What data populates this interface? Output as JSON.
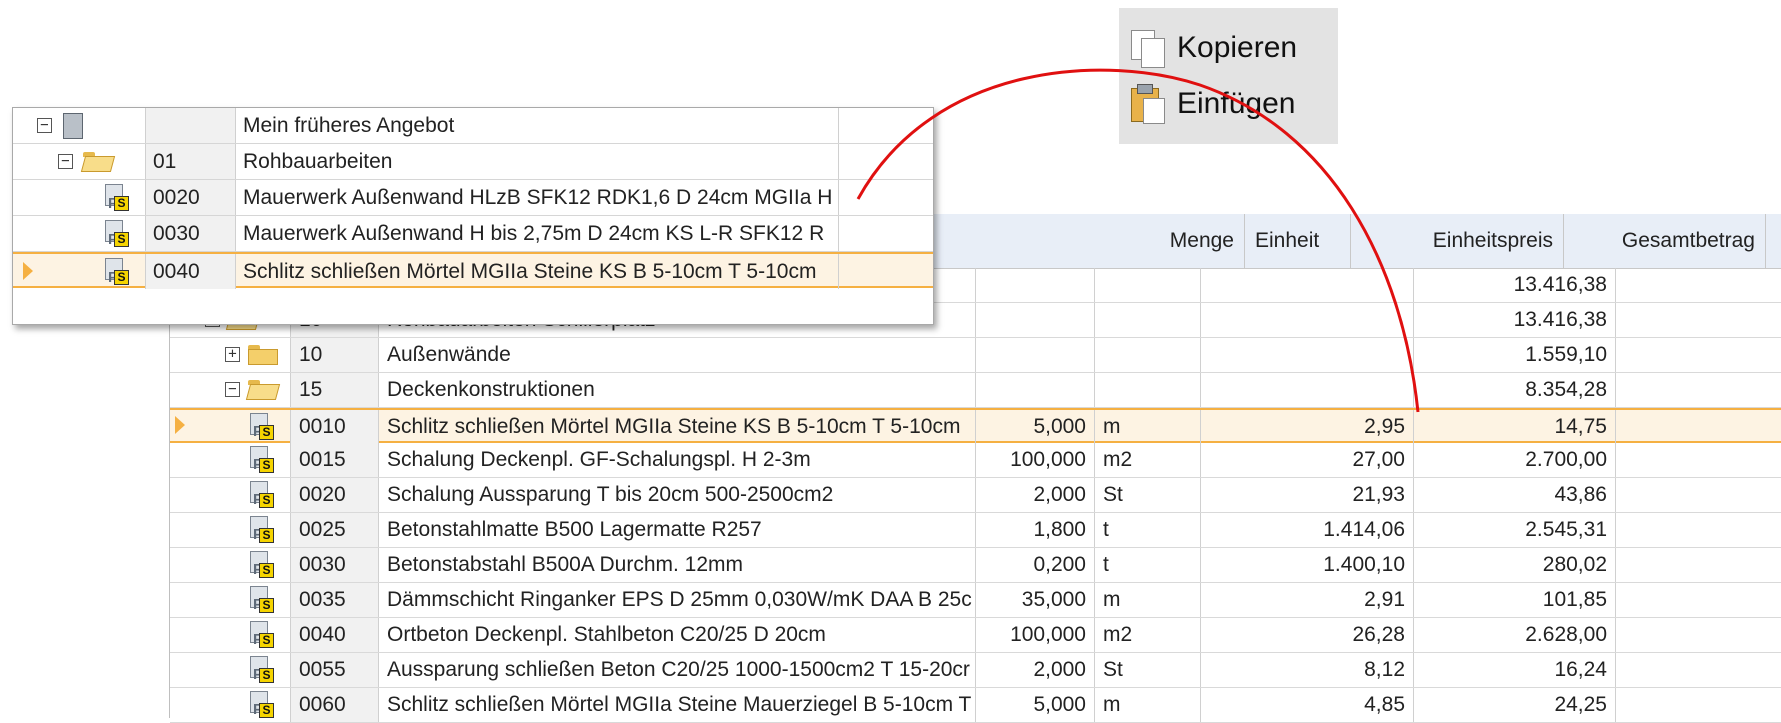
{
  "clipboard": {
    "copy_label": "Kopieren",
    "paste_label": "Einfügen",
    "copy_icon": "copy-icon",
    "paste_icon": "paste-icon"
  },
  "popup": {
    "rows": [
      {
        "code": "",
        "text": "Mein früheres Angebot"
      },
      {
        "code": "01",
        "text": "Rohbauarbeiten"
      },
      {
        "code": "0020",
        "text": "Mauerwerk Außenwand HLzB SFK12 RDK1,6 D 24cm MGIIa H"
      },
      {
        "code": "0030",
        "text": "Mauerwerk Außenwand H bis 2,75m D 24cm KS L-R SFK12 R"
      },
      {
        "code": "0040",
        "text": "Schlitz schließen Mörtel MGIIa Steine KS B 5-10cm T 5-10cm"
      }
    ]
  },
  "grid": {
    "headers": {
      "menge": "Menge",
      "einheit": "Einheit",
      "einheitspreis": "Einheitspreis",
      "gesamtbetrag": "Gesamtbetrag"
    },
    "rows": [
      {
        "code": "",
        "text": "",
        "menge": "",
        "einheit": "",
        "ep": "",
        "gb": "13.416,38"
      },
      {
        "code": "10",
        "text": "Rohbauarbeiten Schillerplatz",
        "menge": "",
        "einheit": "",
        "ep": "",
        "gb": "13.416,38"
      },
      {
        "code": "10",
        "text": "Außenwände",
        "menge": "",
        "einheit": "",
        "ep": "",
        "gb": "1.559,10"
      },
      {
        "code": "15",
        "text": "Deckenkonstruktionen",
        "menge": "",
        "einheit": "",
        "ep": "",
        "gb": "8.354,28"
      },
      {
        "code": "0010",
        "text": "Schlitz schließen Mörtel MGIIa Steine KS B 5-10cm T 5-10cm",
        "menge": "5,000",
        "einheit": "m",
        "ep": "2,95",
        "gb": "14,75"
      },
      {
        "code": "0015",
        "text": "Schalung Deckenpl. GF-Schalungspl. H 2-3m",
        "menge": "100,000",
        "einheit": "m2",
        "ep": "27,00",
        "gb": "2.700,00"
      },
      {
        "code": "0020",
        "text": "Schalung Aussparung T bis 20cm 500-2500cm2",
        "menge": "2,000",
        "einheit": "St",
        "ep": "21,93",
        "gb": "43,86"
      },
      {
        "code": "0025",
        "text": "Betonstahlmatte B500 Lagermatte R257",
        "menge": "1,800",
        "einheit": "t",
        "ep": "1.414,06",
        "gb": "2.545,31"
      },
      {
        "code": "0030",
        "text": "Betonstabstahl B500A Durchm. 12mm",
        "menge": "0,200",
        "einheit": "t",
        "ep": "1.400,10",
        "gb": "280,02"
      },
      {
        "code": "0035",
        "text": "Dämmschicht Ringanker EPS D 25mm 0,030W/mK DAA B 25c",
        "menge": "35,000",
        "einheit": "m",
        "ep": "2,91",
        "gb": "101,85"
      },
      {
        "code": "0040",
        "text": "Ortbeton Deckenpl. Stahlbeton C20/25 D 20cm",
        "menge": "100,000",
        "einheit": "m2",
        "ep": "26,28",
        "gb": "2.628,00"
      },
      {
        "code": "0055",
        "text": "Aussparung schließen Beton C20/25 1000-1500cm2 T 15-20cr",
        "menge": "2,000",
        "einheit": "St",
        "ep": "8,12",
        "gb": "16,24"
      },
      {
        "code": "0060",
        "text": "Schlitz schließen Mörtel MGIIa Steine Mauerziegel B 5-10cm T",
        "menge": "5,000",
        "einheit": "m",
        "ep": "4,85",
        "gb": "24,25"
      }
    ]
  },
  "annotation": {
    "arrow_color": "#e01010"
  }
}
